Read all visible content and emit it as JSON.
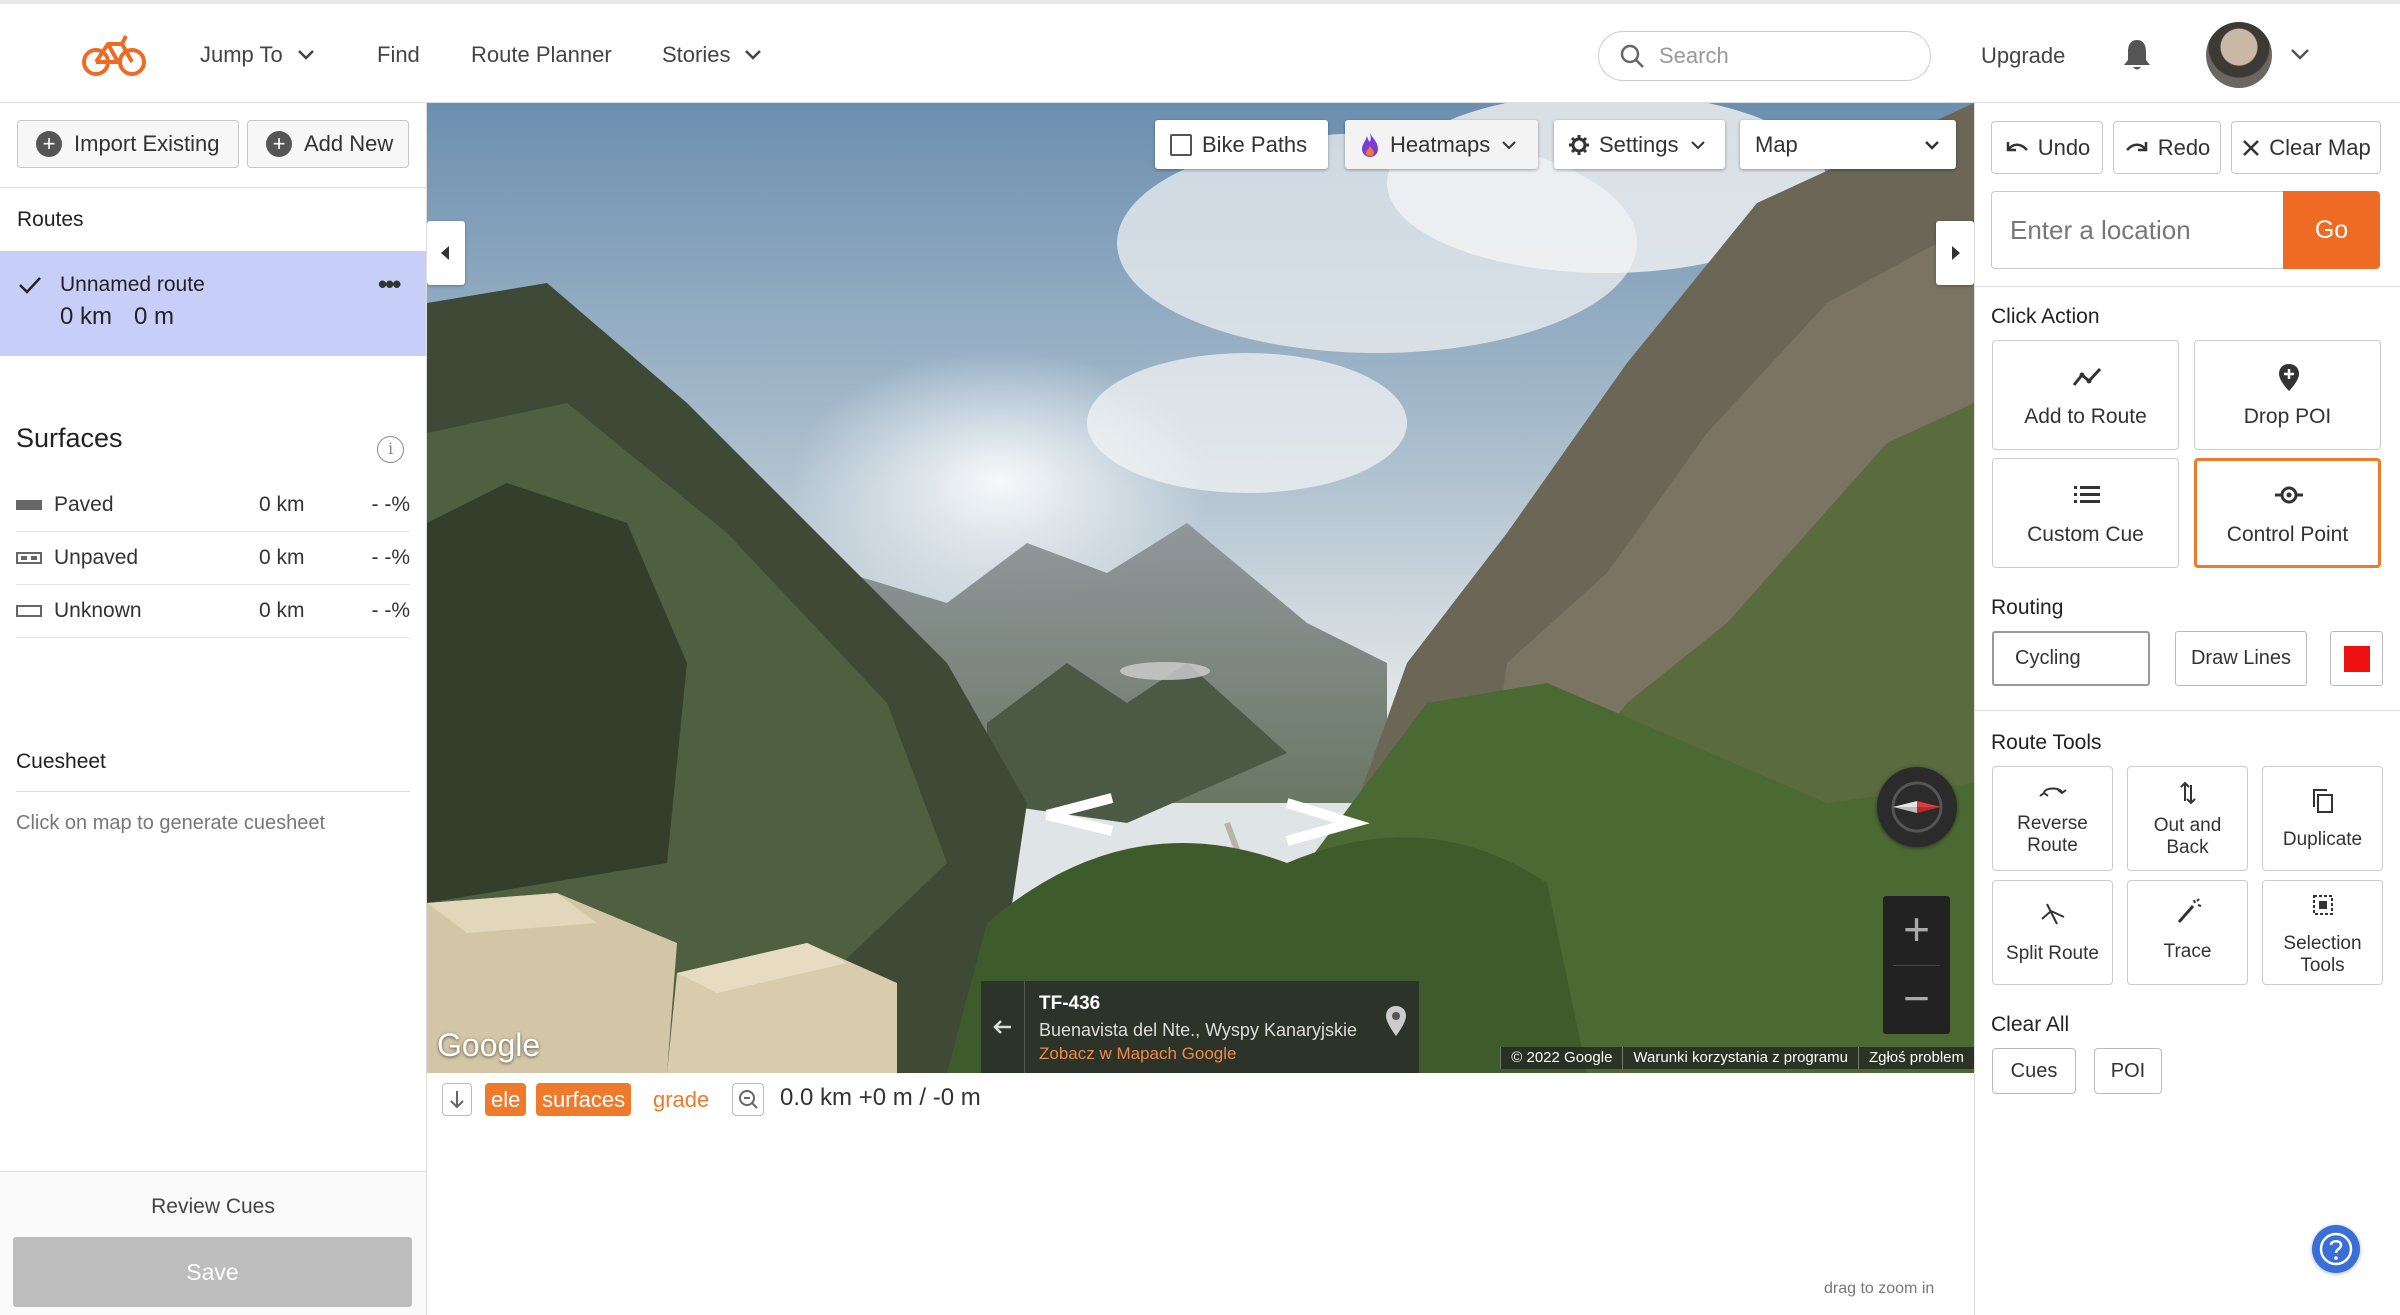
{
  "header": {
    "nav": [
      {
        "label": "Jump To",
        "has_dropdown": true
      },
      {
        "label": "Find",
        "has_dropdown": false
      },
      {
        "label": "Route Planner",
        "has_dropdown": false
      },
      {
        "label": "Stories",
        "has_dropdown": true
      }
    ],
    "search_placeholder": "Search",
    "upgrade_label": "Upgrade",
    "icons": {
      "logo": "bicycle-logo-icon",
      "search": "search-icon",
      "notifications": "bell-icon"
    },
    "brand_color": "#ef6a23"
  },
  "left_sidebar": {
    "import_label": "Import Existing",
    "add_new_label": "Add New",
    "routes_header": "Routes",
    "route": {
      "name": "Unnamed route",
      "distance": "0 km",
      "elevation": "0 m",
      "selected": true
    },
    "surfaces": {
      "title": "Surfaces",
      "rows": [
        {
          "name": "Paved",
          "distance": "0 km",
          "percent": "- -%"
        },
        {
          "name": "Unpaved",
          "distance": "0 km",
          "percent": "- -%"
        },
        {
          "name": "Unknown",
          "distance": "0 km",
          "percent": "- -%"
        }
      ]
    },
    "cuesheet": {
      "title": "Cuesheet",
      "hint": "Click on map to generate cuesheet"
    },
    "review_cues_label": "Review Cues",
    "save_label": "Save"
  },
  "map": {
    "bike_paths_label": "Bike Paths",
    "heatmaps_label": "Heatmaps",
    "settings_label": "Settings",
    "map_type": "Map",
    "street_view": {
      "road": "TF-436",
      "address": "Buenavista del Nte., Wyspy Kanaryjskie",
      "link": "Zobacz w Mapach Google"
    },
    "google_logo": "Google",
    "footer": [
      "© 2022 Google",
      "Warunki korzystania z programu",
      "Zgłoś problem"
    ]
  },
  "elevation": {
    "tags": {
      "ele": "ele",
      "surfaces": "surfaces",
      "grade": "grade"
    },
    "stats": "0.0 km +0 m / -0 m",
    "hint": "drag to zoom in"
  },
  "right_sidebar": {
    "undo_label": "Undo",
    "redo_label": "Redo",
    "clear_map_label": "Clear Map",
    "location_placeholder": "Enter a location",
    "go_label": "Go",
    "click_action": {
      "title": "Click Action",
      "options": [
        {
          "label": "Add to Route",
          "icon": "route-line-icon",
          "active": false
        },
        {
          "label": "Drop POI",
          "icon": "poi-pin-icon",
          "active": false
        },
        {
          "label": "Custom Cue",
          "icon": "list-icon",
          "active": false
        },
        {
          "label": "Control Point",
          "icon": "control-point-icon",
          "active": true
        }
      ]
    },
    "routing": {
      "title": "Routing",
      "mode": "Cycling",
      "draw_lines_label": "Draw Lines",
      "line_color": "#ee1111"
    },
    "route_tools": {
      "title": "Route Tools",
      "tools": [
        {
          "label": "Reverse Route",
          "icon": "reverse-icon"
        },
        {
          "label": "Out and Back",
          "icon": "out-and-back-icon"
        },
        {
          "label": "Duplicate",
          "icon": "duplicate-icon"
        },
        {
          "label": "Split Route",
          "icon": "split-icon"
        },
        {
          "label": "Trace",
          "icon": "trace-wand-icon"
        },
        {
          "label": "Selection Tools",
          "icon": "selection-icon"
        }
      ]
    },
    "clear_all": {
      "title": "Clear All",
      "cues_label": "Cues",
      "poi_label": "POI"
    },
    "accent_color": "#ef7a2b"
  }
}
